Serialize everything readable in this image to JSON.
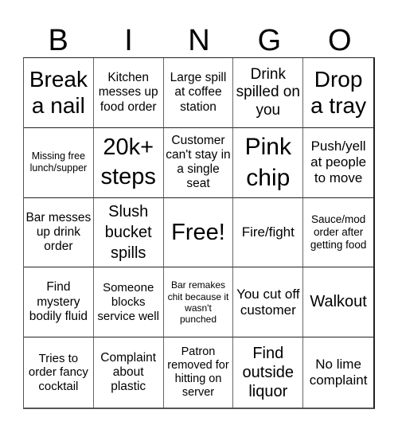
{
  "header": {
    "letters": [
      "B",
      "I",
      "N",
      "G",
      "O"
    ]
  },
  "cells": [
    "Break a nail",
    "Kitchen messes up food order",
    "Large spill at coffee station",
    "Drink spilled on you",
    "Drop a tray",
    "Missing free lunch/supper",
    "20k+ steps",
    "Customer can't stay in a single seat",
    "Pink chip",
    "Push/yell at people to move",
    "Bar messes up drink order",
    "Slush bucket spills",
    "Free!",
    "Fire/fight",
    "Sauce/mod order after getting food",
    "Find mystery bodily fluid",
    "Someone blocks service well",
    "Bar remakes chit because it wasn't punched",
    "You cut off customer",
    "Walkout",
    "Tries to order fancy cocktail",
    "Complaint about plastic",
    "Patron removed for hitting on server",
    "Find outside liquor",
    "No lime complaint"
  ]
}
